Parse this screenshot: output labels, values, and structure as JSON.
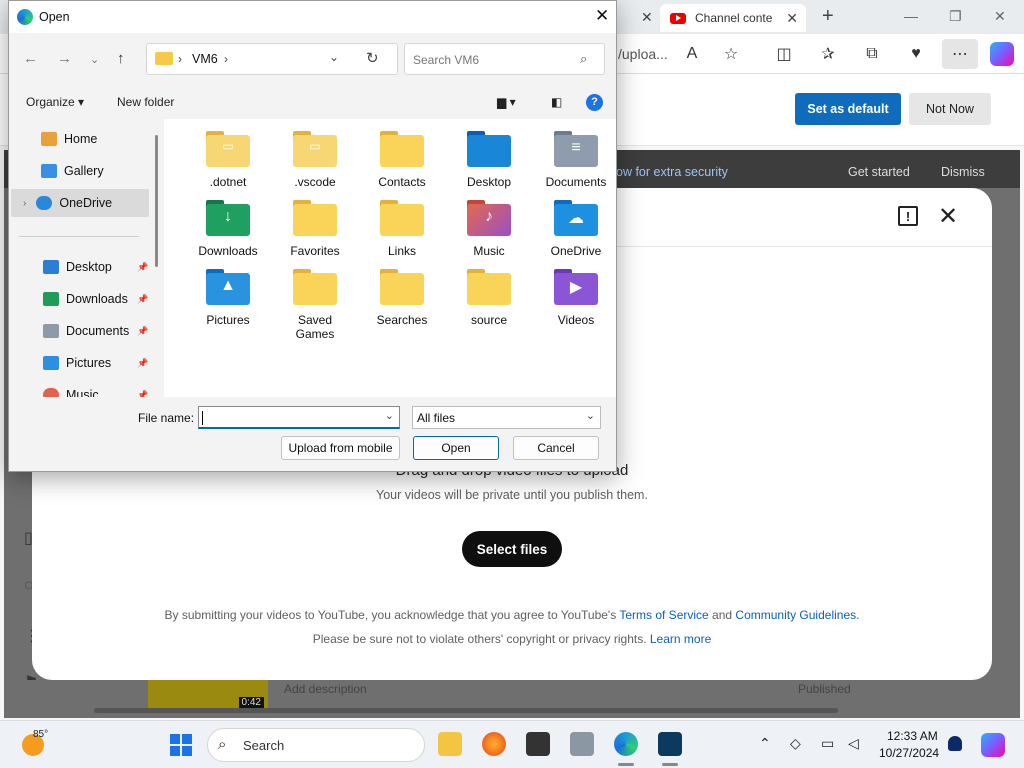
{
  "browser": {
    "tabs": [
      {
        "label": "Channel conte"
      }
    ],
    "address_fragment": "/uploa...",
    "default_bar": {
      "set_default": "Set as default",
      "not_now": "Not Now"
    },
    "security_bar": {
      "text": "ow for extra security",
      "get_started": "Get started",
      "dismiss": "Dismiss"
    }
  },
  "youtube_dialog": {
    "drag_text": "Drag and drop video files to upload",
    "private_text": "Your videos will be private until you publish them.",
    "select_files": "Select files",
    "legal_prefix": "By submitting your videos to YouTube, you acknowledge that you agree to YouTube's ",
    "terms": "Terms of Service",
    "and": " and ",
    "community": "Community Guidelines",
    "legal_suffix": ".",
    "legal2_prefix": "Please be sure not to violate others' copyright or privacy rights. ",
    "learn_more": "Learn more",
    "row": {
      "duration": "0:42",
      "add_description": "Add description",
      "status": "Published"
    }
  },
  "open_dialog": {
    "title": "Open",
    "path": "VM6",
    "search_placeholder": "Search VM6",
    "organize": "Organize",
    "new_folder": "New folder",
    "nav_items": [
      {
        "label": "Home",
        "icon": "home-icon"
      },
      {
        "label": "Gallery",
        "icon": "gallery-icon"
      },
      {
        "label": "OneDrive",
        "icon": "onedrive-icon"
      },
      {
        "label": "Desktop",
        "icon": "desktop-icon"
      },
      {
        "label": "Downloads",
        "icon": "downloads-icon"
      },
      {
        "label": "Documents",
        "icon": "documents-icon"
      },
      {
        "label": "Pictures",
        "icon": "pictures-icon"
      },
      {
        "label": "Music",
        "icon": "music-icon"
      }
    ],
    "files": [
      {
        "label": ".dotnet"
      },
      {
        "label": ".vscode"
      },
      {
        "label": "Contacts"
      },
      {
        "label": "Desktop"
      },
      {
        "label": "Documents"
      },
      {
        "label": "Downloads"
      },
      {
        "label": "Favorites"
      },
      {
        "label": "Links"
      },
      {
        "label": "Music"
      },
      {
        "label": "OneDrive"
      },
      {
        "label": "Pictures"
      },
      {
        "label": "Saved Games"
      },
      {
        "label": "Searches"
      },
      {
        "label": "source"
      },
      {
        "label": "Videos"
      }
    ],
    "file_name_label": "File name:",
    "file_name_value": "",
    "filter": "All files",
    "upload_mobile": "Upload from mobile",
    "open": "Open",
    "cancel": "Cancel"
  },
  "taskbar": {
    "temperature": "85°",
    "search": "Search",
    "time": "12:33 AM",
    "date": "10/27/2024"
  },
  "colors": {
    "accent": "#0f6cbd",
    "yt_link": "#065fd4",
    "folder": "#f7c948"
  }
}
